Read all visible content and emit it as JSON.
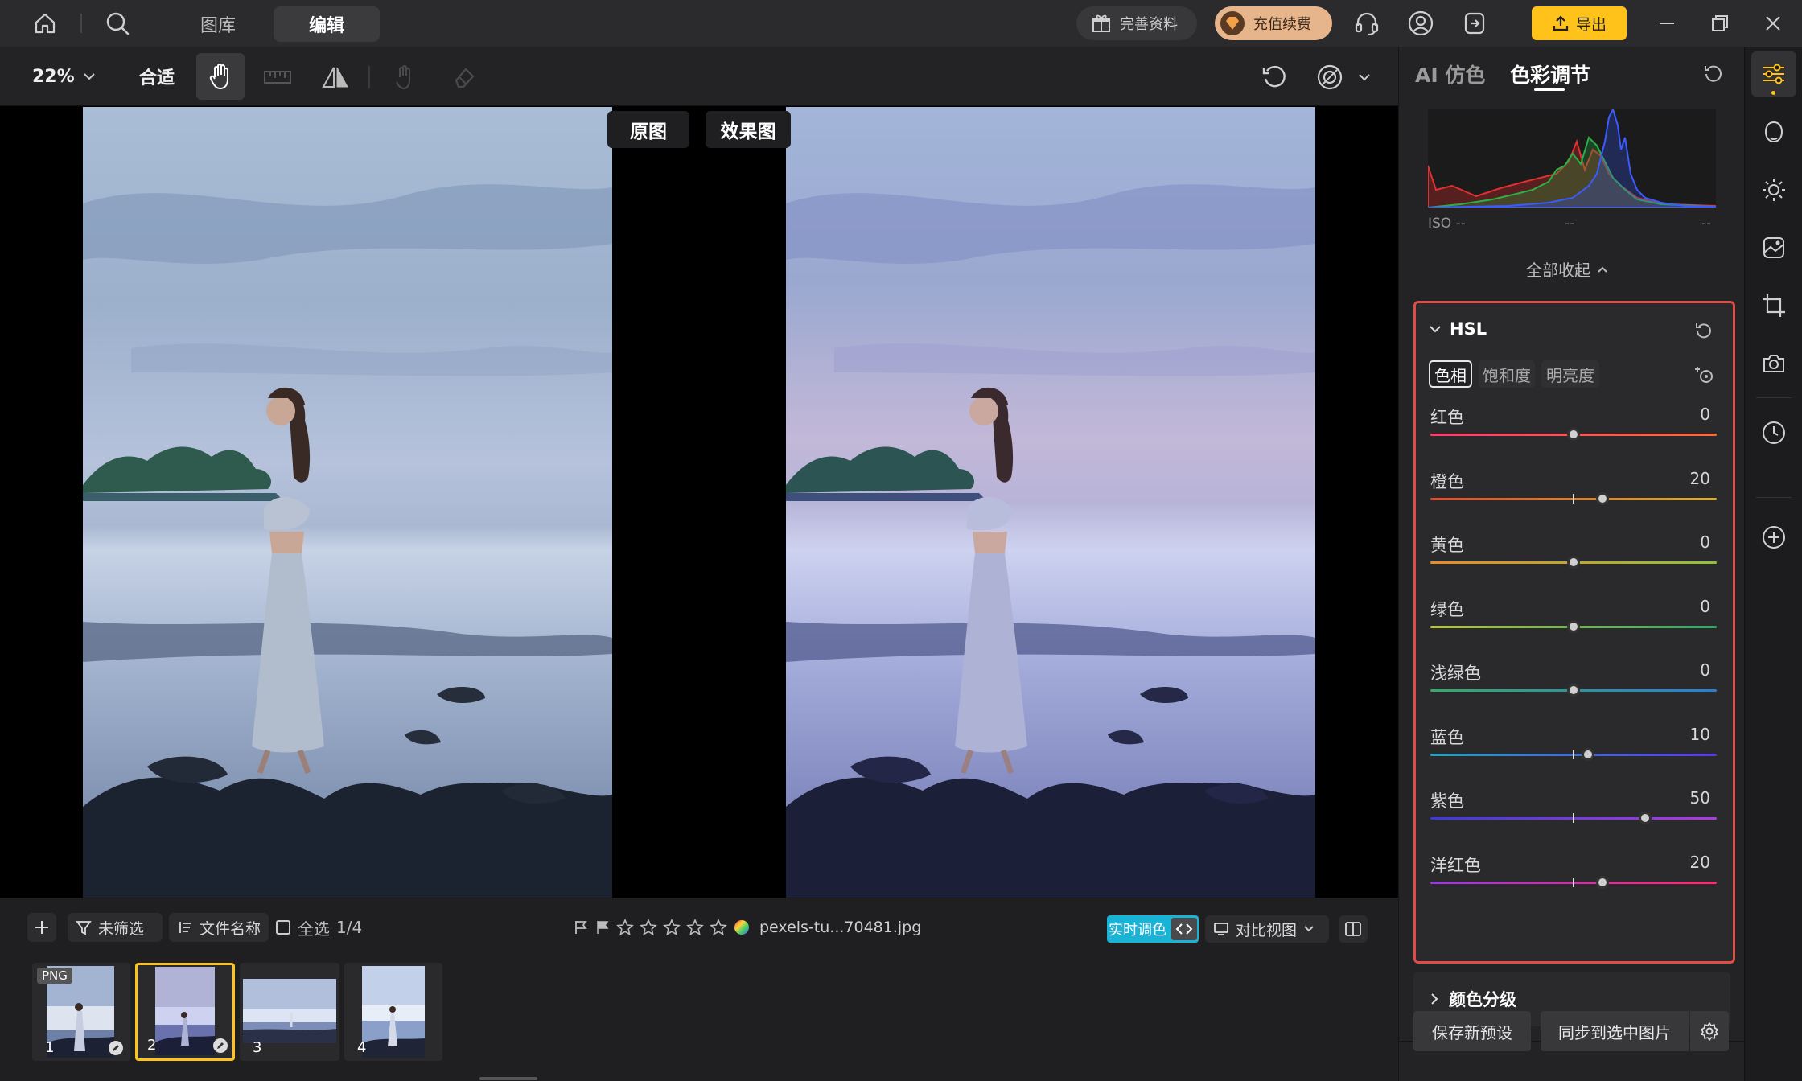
{
  "topbar": {
    "tabs": [
      {
        "label": "图库"
      },
      {
        "label": "编辑"
      }
    ],
    "complete_profile": "完善资料",
    "recharge": "充值续费",
    "export": "导出"
  },
  "toolbar": {
    "zoom": "22%",
    "fit": "合适"
  },
  "canvas": {
    "original_label": "原图",
    "effect_label": "效果图"
  },
  "bottom": {
    "filter": "未筛选",
    "sort": "文件名称",
    "select_all": "全选",
    "count": "1/4",
    "filename": "pexels-tu...70481.jpg",
    "realtime": "实时调色",
    "compare_view": "对比视图",
    "rating": 0,
    "thumbnails": [
      {
        "num": "1",
        "badge": "PNG",
        "selected": false
      },
      {
        "num": "2",
        "badge": "",
        "selected": true
      },
      {
        "num": "3",
        "badge": "",
        "selected": false
      },
      {
        "num": "4",
        "badge": "",
        "selected": false
      }
    ]
  },
  "panel": {
    "tabs": [
      {
        "label": "AI 仿色"
      },
      {
        "label": "色彩调节"
      }
    ],
    "histogram": {
      "iso": "ISO --",
      "mid": "--",
      "right": "--"
    },
    "collapse_all": "全部收起",
    "hsl": {
      "title": "HSL",
      "subtabs": [
        {
          "label": "色相"
        },
        {
          "label": "饱和度"
        },
        {
          "label": "明亮度"
        }
      ],
      "rows": [
        {
          "label": "红色",
          "value": "0",
          "level": 0
        },
        {
          "label": "橙色",
          "value": "20",
          "level": 20
        },
        {
          "label": "黄色",
          "value": "0",
          "level": 0
        },
        {
          "label": "绿色",
          "value": "0",
          "level": 0
        },
        {
          "label": "浅绿色",
          "value": "0",
          "level": 0
        },
        {
          "label": "蓝色",
          "value": "10",
          "level": 10
        },
        {
          "label": "紫色",
          "value": "50",
          "level": 50
        },
        {
          "label": "洋红色",
          "value": "20",
          "level": 20
        }
      ]
    },
    "color_grading": "颜色分级",
    "save_preset": "保存新预设",
    "sync_selected": "同步到选中图片"
  },
  "colors": {
    "accent_yellow": "#ffc21a",
    "accent_cyan": "#19b3d6",
    "highlight_red": "#e04b45"
  }
}
